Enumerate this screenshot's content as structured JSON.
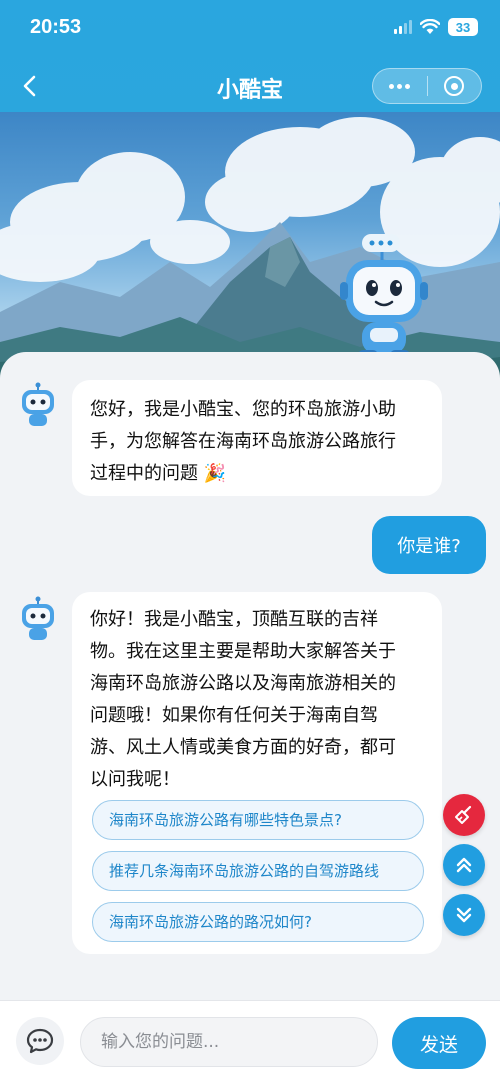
{
  "status_bar": {
    "time": "20:53",
    "battery": "33"
  },
  "nav": {
    "title": "小酷宝"
  },
  "messages": [
    {
      "role": "bot",
      "lines": [
        "您好，我是小酷宝、您的环岛旅游小助",
        "手，为您解答在海南环岛旅游公路旅行",
        "过程中的问题 🎉"
      ]
    },
    {
      "role": "user",
      "text": "你是谁?"
    },
    {
      "role": "bot",
      "lines": [
        "你好！我是小酷宝，顶酷互联的吉祥",
        "物。我在这里主要是帮助大家解答关于",
        "海南环岛旅游公路以及海南旅游相关的",
        "问题哦！如果你有任何关于海南自驾",
        "游、风土人情或美食方面的好奇，都可",
        "以问我呢！"
      ]
    }
  ],
  "suggestions": [
    "海南环岛旅游公路有哪些特色景点?",
    "推荐几条海南环岛旅游公路的自驾游路线",
    "海南环岛旅游公路的路况如何?"
  ],
  "input": {
    "placeholder": "输入您的问题..."
  },
  "send_label": "发送",
  "colors": {
    "primary": "#219ee0",
    "clear": "#e5283e",
    "header": "#2aa6df"
  },
  "icons": [
    "back-arrow-icon",
    "more-dots-icon",
    "target-circle-icon",
    "broom-icon",
    "double-chevron-up-icon",
    "double-chevron-down-icon",
    "chat-bubble-icon"
  ]
}
